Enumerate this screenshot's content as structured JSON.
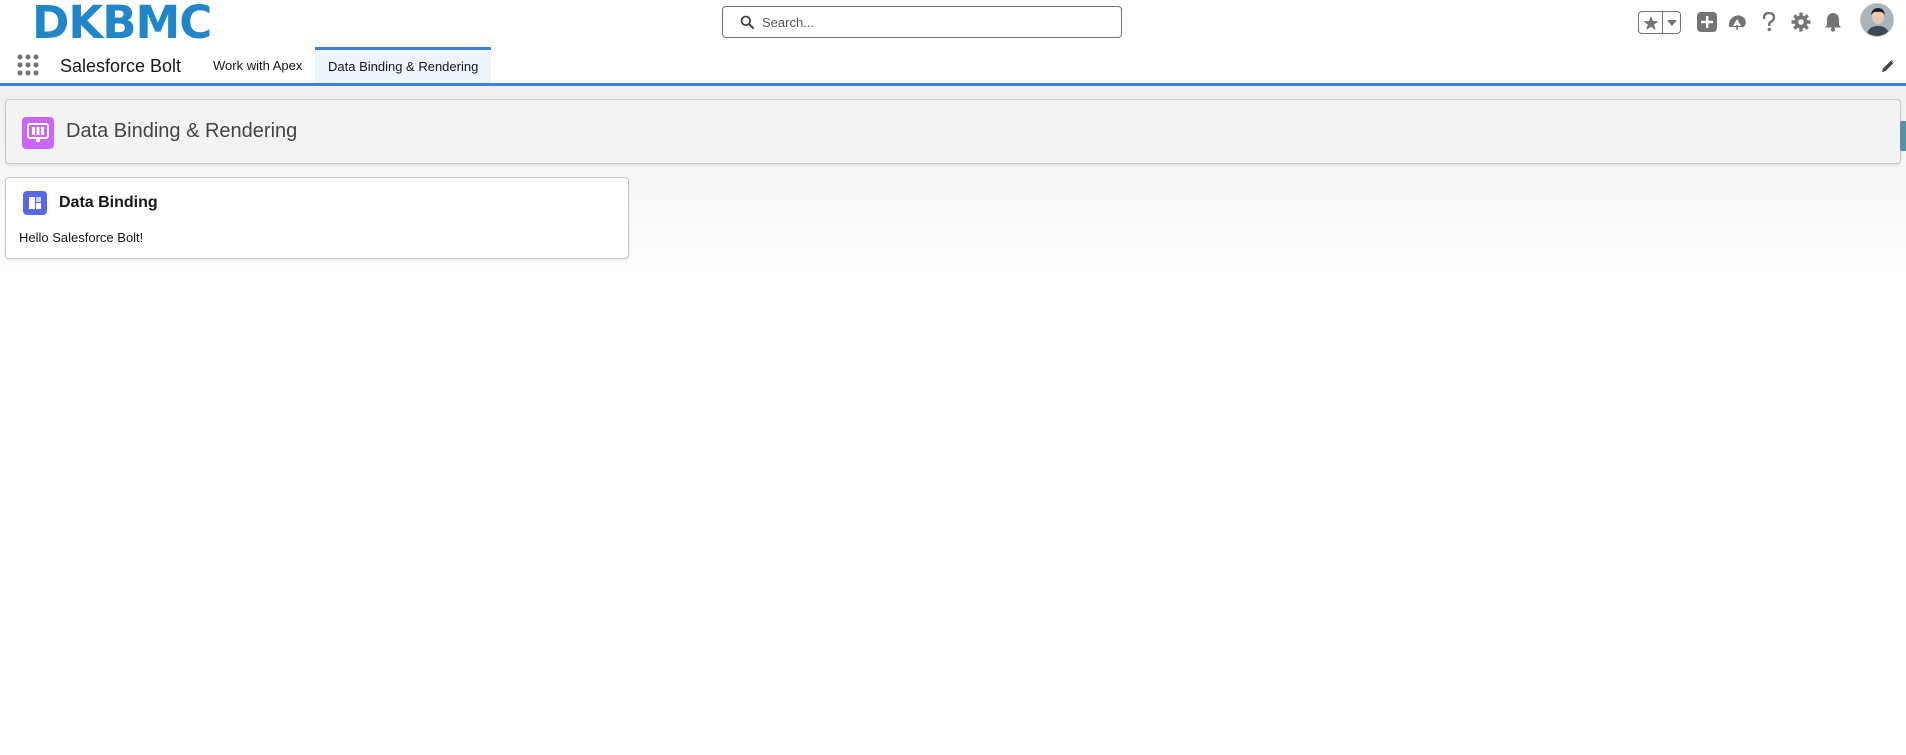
{
  "header": {
    "logo_text": "DKBMC",
    "search": {
      "placeholder": "Search...",
      "value": ""
    },
    "icons": [
      "star-icon",
      "chevron-down-icon",
      "add-icon",
      "trailhead-icon",
      "help-icon",
      "gear-icon",
      "bell-icon",
      "avatar"
    ]
  },
  "nav": {
    "app_name": "Salesforce Bolt",
    "tabs": [
      {
        "label": "Work with Apex",
        "active": false
      },
      {
        "label": "Data Binding & Rendering",
        "active": true
      }
    ]
  },
  "page": {
    "title": "Data Binding & Rendering"
  },
  "card": {
    "title": "Data Binding",
    "body": "Hello Salesforce Bolt!"
  },
  "colors": {
    "brand_blue": "#1f86c9",
    "tab_accent": "#3b82e0",
    "page_icon": "#cb65ff",
    "card_icon": "#5867e8",
    "icon_gray": "#747474"
  }
}
